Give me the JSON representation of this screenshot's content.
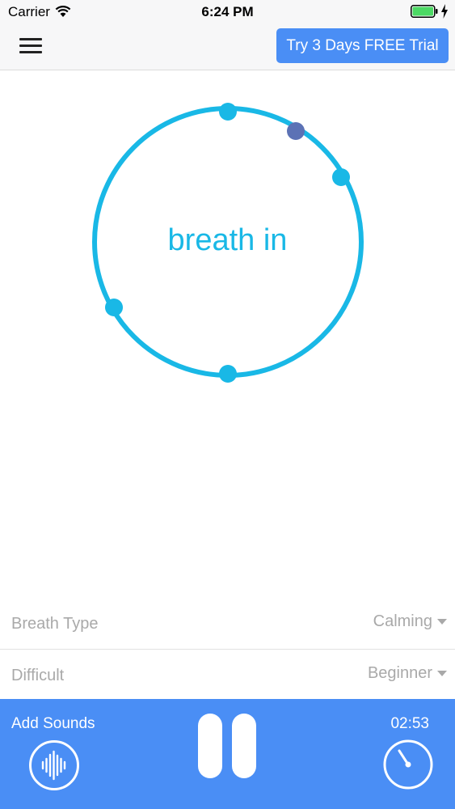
{
  "status_bar": {
    "carrier": "Carrier",
    "time": "6:24 PM",
    "icons": [
      "wifi-icon",
      "battery-icon",
      "charging-bolt-icon"
    ],
    "battery_color": "#4cd964"
  },
  "header": {
    "menu_icon": "hamburger-menu-icon",
    "trial_button_label": "Try 3 Days FREE Trial"
  },
  "breath": {
    "instruction": "breath in",
    "ring_color": "#19b8e6",
    "progress_dot_color": "#5c72b5"
  },
  "options": {
    "breath_type": {
      "label": "Breath Type",
      "value": "Calming"
    },
    "difficulty": {
      "label": "Difficult",
      "value": "Beginner"
    }
  },
  "controls": {
    "add_sounds_label": "Add Sounds",
    "timer": "02:53",
    "sounds_icon": "sound-wave-icon",
    "play_state_icon": "pause-icon",
    "timer_icon": "timer-icon",
    "accent_color": "#4a8ef5"
  }
}
